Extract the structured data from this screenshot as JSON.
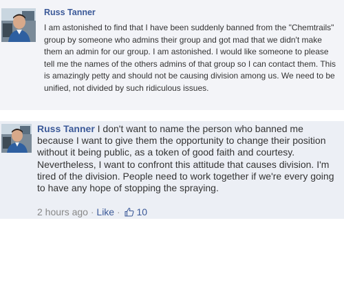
{
  "post1": {
    "author": "Russ Tanner",
    "body": "I am astonished to find that I have been suddenly banned from the \"Chemtrails\" group by someone who admins their group and got mad that we didn't make them an admin for our group. I am astonished. I would like someone to please tell me the names of the others admins of that group so I can contact them. This is amazingly petty and should not be causing division among us. We need to be unified, not divided by such ridiculous issues."
  },
  "post2": {
    "author": "Russ Tanner",
    "body": " I don't want to name the person who banned me because I want to give them the opportunity to change their position without it being public, as a token of good faith and courtesy. Nevertheless, I want to confront this attitude that causes division. I'm tired of the division. People need to work together if we're every going to have any hope of stopping the spraying.",
    "timestamp": "2 hours ago",
    "separator": "·",
    "like_label": "Like",
    "like_count": "10"
  },
  "colors": {
    "link": "#3b5998",
    "text": "#333333",
    "meta": "#888888",
    "post1_bg": "#f3f4f8",
    "post2_bg": "#eceff5"
  },
  "icons": {
    "avatar": "profile-photo",
    "like": "thumbs-up-icon"
  }
}
